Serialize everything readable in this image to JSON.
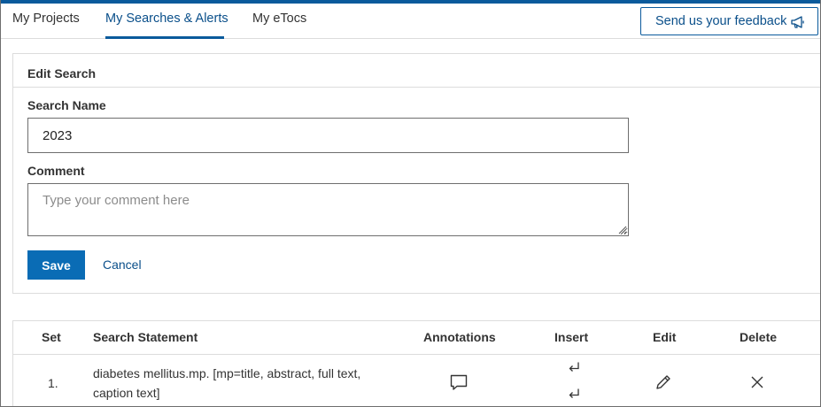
{
  "tabs": [
    {
      "label": "My Projects",
      "active": false
    },
    {
      "label": "My Searches & Alerts",
      "active": true
    },
    {
      "label": "My eTocs",
      "active": false
    }
  ],
  "feedback": {
    "label": "Send us your feedback",
    "icon": "megaphone-icon"
  },
  "edit_search": {
    "title": "Edit Search",
    "name_label": "Search Name",
    "name_value": "2023",
    "comment_label": "Comment",
    "comment_placeholder": "Type your comment here",
    "save_label": "Save",
    "cancel_label": "Cancel"
  },
  "results": {
    "columns": [
      "Set",
      "Search Statement",
      "Annotations",
      "Insert",
      "Edit",
      "Delete"
    ],
    "rows": [
      {
        "set": "1.",
        "statement": "diabetes mellitus.mp. [mp=title, abstract, full text, caption text]",
        "icons": [
          "speech-bubble-icon",
          "insert-before-icon",
          "insert-after-icon",
          "pencil-icon",
          "close-icon"
        ]
      }
    ]
  },
  "colors": {
    "accent": "#0a5a9c",
    "button": "#0a6cb5",
    "border": "#dcdcdc",
    "text": "#333333"
  }
}
